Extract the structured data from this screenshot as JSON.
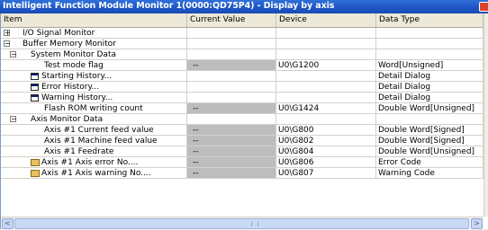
{
  "window": {
    "title": "Intelligent Function Module Monitor 1(0000:QD75P4) - Display by axis",
    "accent_color": "#1d55c4"
  },
  "columns": {
    "item": "Item",
    "current_value": "Current Value",
    "device": "Device",
    "data_type": "Data Type"
  },
  "rows": [
    {
      "label": "I/O Signal Monitor",
      "toggle": "+",
      "icon": "",
      "current": "",
      "gray": false,
      "device": "",
      "type": ""
    },
    {
      "label": "Buffer Memory Monitor",
      "toggle": "−",
      "icon": "",
      "current": "",
      "gray": false,
      "device": "",
      "type": ""
    },
    {
      "label": "System Monitor Data",
      "toggle": "−",
      "icon": "",
      "current": "",
      "gray": false,
      "device": "",
      "type": ""
    },
    {
      "label": "Test mode flag",
      "toggle": "",
      "icon": "",
      "current": "--",
      "gray": true,
      "device": "U0\\G1200",
      "type": "Word[Unsigned]"
    },
    {
      "label": "Starting History...",
      "toggle": "",
      "icon": "dialog-icon",
      "current": "",
      "gray": false,
      "device": "",
      "type": "Detail Dialog"
    },
    {
      "label": "Error History...",
      "toggle": "",
      "icon": "dialog-icon",
      "current": "",
      "gray": false,
      "device": "",
      "type": "Detail Dialog"
    },
    {
      "label": "Warning History...",
      "toggle": "",
      "icon": "dialog-icon",
      "current": "",
      "gray": false,
      "device": "",
      "type": "Detail Dialog"
    },
    {
      "label": "Flash ROM writing count",
      "toggle": "",
      "icon": "",
      "current": "--",
      "gray": true,
      "device": "U0\\G1424",
      "type": "Double Word[Unsigned]"
    },
    {
      "label": "Axis Monitor Data",
      "toggle": "−",
      "icon": "",
      "current": "",
      "gray": false,
      "device": "",
      "type": ""
    },
    {
      "label": "Axis #1 Current feed value",
      "toggle": "",
      "icon": "",
      "current": "--",
      "gray": true,
      "device": "U0\\G800",
      "type": "Double Word[Signed]"
    },
    {
      "label": "Axis #1 Machine feed value",
      "toggle": "",
      "icon": "",
      "current": "--",
      "gray": true,
      "device": "U0\\G802",
      "type": "Double Word[Signed]"
    },
    {
      "label": "Axis #1 Feedrate",
      "toggle": "",
      "icon": "",
      "current": "--",
      "gray": true,
      "device": "U0\\G804",
      "type": "Double Word[Unsigned]"
    },
    {
      "label": "Axis #1 Axis error No....",
      "toggle": "",
      "icon": "error-code-icon",
      "current": "--",
      "gray": true,
      "device": "U0\\G806",
      "type": "Error Code"
    },
    {
      "label": "Axis #1 Axis warning No....",
      "toggle": "",
      "icon": "error-code-icon",
      "current": "--",
      "gray": true,
      "device": "U0\\G807",
      "type": "Warning Code"
    }
  ],
  "scrollbar": {
    "left_arrow": "<",
    "right_arrow": ">"
  }
}
